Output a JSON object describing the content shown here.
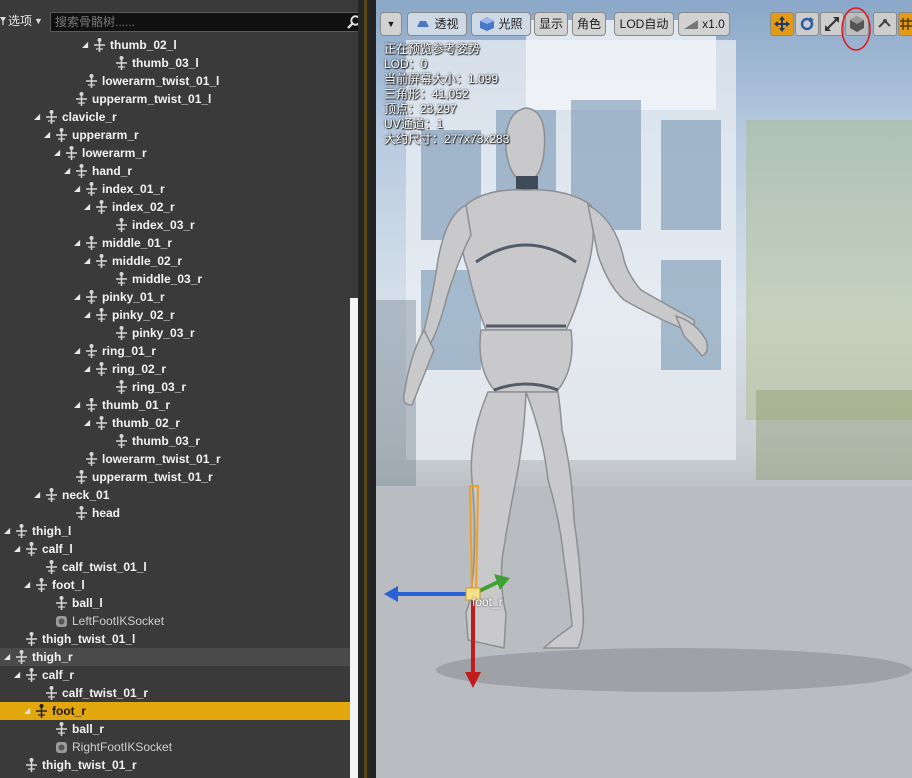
{
  "left_panel": {
    "options_label": "选项",
    "search_placeholder": "搜索骨骼树......",
    "tree": [
      {
        "label": "thumb_02_l",
        "indent": 92,
        "arrow": true,
        "selected": ""
      },
      {
        "label": "thumb_03_l",
        "indent": 114,
        "arrow": false,
        "selected": ""
      },
      {
        "label": "lowerarm_twist_01_l",
        "indent": 84,
        "arrow": false,
        "selected": ""
      },
      {
        "label": "upperarm_twist_01_l",
        "indent": 74,
        "arrow": false,
        "selected": ""
      },
      {
        "label": "clavicle_r",
        "indent": 44,
        "arrow": true,
        "selected": ""
      },
      {
        "label": "upperarm_r",
        "indent": 54,
        "arrow": true,
        "selected": ""
      },
      {
        "label": "lowerarm_r",
        "indent": 64,
        "arrow": true,
        "selected": ""
      },
      {
        "label": "hand_r",
        "indent": 74,
        "arrow": true,
        "selected": ""
      },
      {
        "label": "index_01_r",
        "indent": 84,
        "arrow": true,
        "selected": ""
      },
      {
        "label": "index_02_r",
        "indent": 94,
        "arrow": true,
        "selected": ""
      },
      {
        "label": "index_03_r",
        "indent": 114,
        "arrow": false,
        "selected": ""
      },
      {
        "label": "middle_01_r",
        "indent": 84,
        "arrow": true,
        "selected": ""
      },
      {
        "label": "middle_02_r",
        "indent": 94,
        "arrow": true,
        "selected": ""
      },
      {
        "label": "middle_03_r",
        "indent": 114,
        "arrow": false,
        "selected": ""
      },
      {
        "label": "pinky_01_r",
        "indent": 84,
        "arrow": true,
        "selected": ""
      },
      {
        "label": "pinky_02_r",
        "indent": 94,
        "arrow": true,
        "selected": ""
      },
      {
        "label": "pinky_03_r",
        "indent": 114,
        "arrow": false,
        "selected": ""
      },
      {
        "label": "ring_01_r",
        "indent": 84,
        "arrow": true,
        "selected": ""
      },
      {
        "label": "ring_02_r",
        "indent": 94,
        "arrow": true,
        "selected": ""
      },
      {
        "label": "ring_03_r",
        "indent": 114,
        "arrow": false,
        "selected": ""
      },
      {
        "label": "thumb_01_r",
        "indent": 84,
        "arrow": true,
        "selected": ""
      },
      {
        "label": "thumb_02_r",
        "indent": 94,
        "arrow": true,
        "selected": ""
      },
      {
        "label": "thumb_03_r",
        "indent": 114,
        "arrow": false,
        "selected": ""
      },
      {
        "label": "lowerarm_twist_01_r",
        "indent": 84,
        "arrow": false,
        "selected": ""
      },
      {
        "label": "upperarm_twist_01_r",
        "indent": 74,
        "arrow": false,
        "selected": ""
      },
      {
        "label": "neck_01",
        "indent": 44,
        "arrow": true,
        "selected": ""
      },
      {
        "label": "head",
        "indent": 74,
        "arrow": false,
        "selected": ""
      },
      {
        "label": "thigh_l",
        "indent": 14,
        "arrow": true,
        "selected": ""
      },
      {
        "label": "calf_l",
        "indent": 24,
        "arrow": true,
        "selected": ""
      },
      {
        "label": "calf_twist_01_l",
        "indent": 44,
        "arrow": false,
        "selected": ""
      },
      {
        "label": "foot_l",
        "indent": 34,
        "arrow": true,
        "selected": ""
      },
      {
        "label": "ball_l",
        "indent": 54,
        "arrow": false,
        "selected": ""
      },
      {
        "label": "LeftFootIKSocket",
        "indent": 54,
        "arrow": false,
        "selected": "",
        "socket": true
      },
      {
        "label": "thigh_twist_01_l",
        "indent": 24,
        "arrow": false,
        "selected": ""
      },
      {
        "label": "thigh_r",
        "indent": 14,
        "arrow": true,
        "selected": "muted"
      },
      {
        "label": "calf_r",
        "indent": 24,
        "arrow": true,
        "selected": ""
      },
      {
        "label": "calf_twist_01_r",
        "indent": 44,
        "arrow": false,
        "selected": ""
      },
      {
        "label": "foot_r",
        "indent": 34,
        "arrow": true,
        "selected": "active"
      },
      {
        "label": "ball_r",
        "indent": 54,
        "arrow": false,
        "selected": ""
      },
      {
        "label": "RightFootIKSocket",
        "indent": 54,
        "arrow": false,
        "selected": "",
        "socket": true
      },
      {
        "label": "thigh_twist_01_r",
        "indent": 24,
        "arrow": false,
        "selected": ""
      }
    ]
  },
  "viewport": {
    "toolbar": {
      "perspective": "透视",
      "lit": "光照",
      "show": "显示",
      "character": "角色",
      "lod": "LOD自动",
      "speed": "x1.0"
    },
    "stats": {
      "preview_pose": "正在预览参考姿势",
      "lod": "LOD：0",
      "screen_size": "当前屏幕大小：1.099",
      "triangles": "三角形：41,052",
      "vertices": "顶点：23,297",
      "uv_channels": "UV通道：1",
      "approx_size": "大约尺寸：277x73x283"
    },
    "bone_label": "foot_r",
    "accent_color": "#e39a15"
  }
}
